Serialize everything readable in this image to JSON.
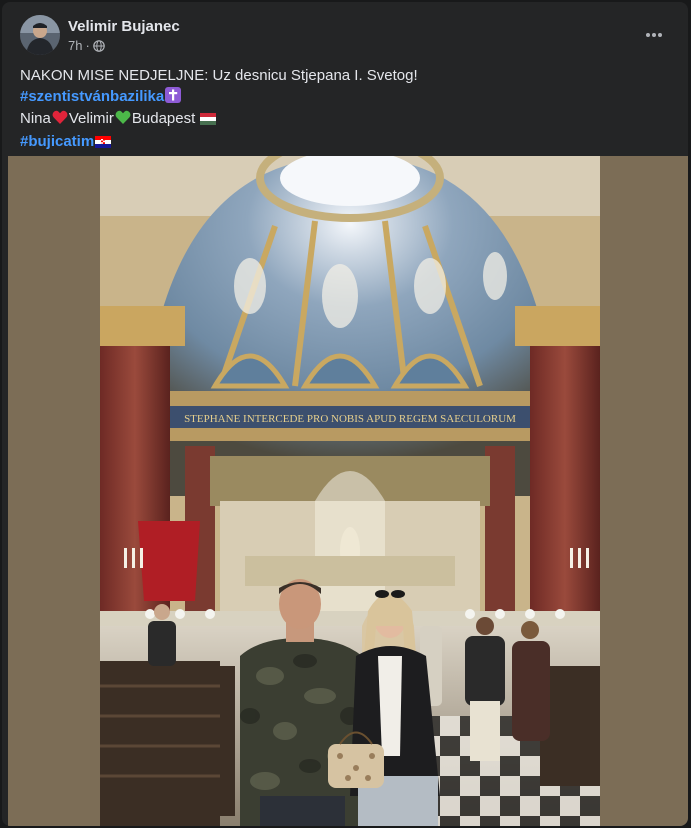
{
  "post": {
    "author": "Velimir Bujanec",
    "time": "7h",
    "line1": "NAKON MISE NEDJELJNE: Uz desnicu Stjepana I. Svetog!",
    "hashtag1": "#szentistvánbazilika",
    "line3_name1": "Nina",
    "line3_name2": "Velimir",
    "line3_place": "Budapest",
    "hashtag2": "#bujicatim",
    "inscription": "STEPHANE INTERCEDE PRO NOBIS APUD REGEM SAECULORUM"
  },
  "icons": {
    "privacy": "globe-icon",
    "menu": "more-options-icon",
    "emoji_cross": "latin-cross-emoji",
    "emoji_heart_red": "red-heart-emoji",
    "emoji_heart_green": "green-heart-emoji",
    "flag_hungary": "hungary-flag-icon",
    "flag_croatia": "croatia-flag-icon"
  },
  "colors": {
    "card_bg": "#242526",
    "hashtag": "#4599ff",
    "media_bg": "#7c6d56"
  }
}
